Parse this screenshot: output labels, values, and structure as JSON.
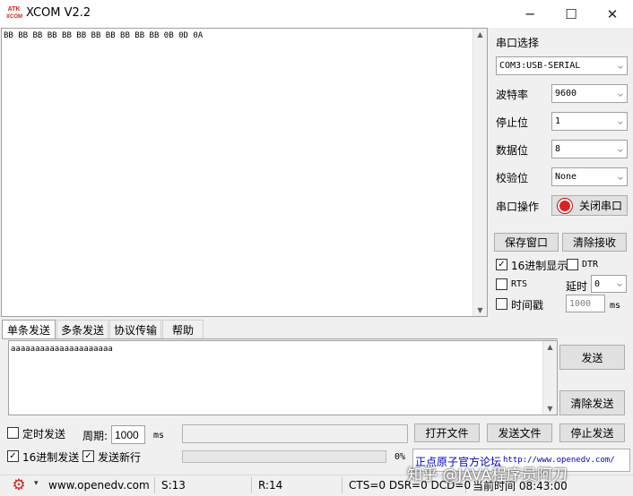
{
  "window": {
    "title": "XCOM V2.2",
    "logo_top": "ATK",
    "logo_bottom": "XCOM",
    "btn_min": "─",
    "btn_max": "☐",
    "btn_close": "✕"
  },
  "receive": {
    "text": "BB BB BB BB BB BB BB BB BB BB BB 0B 0D 0A"
  },
  "panel": {
    "port_title": "串口选择",
    "port_value": "COM3:USB-SERIAL",
    "baud_label": "波特率",
    "baud_value": "9600",
    "stop_label": "停止位",
    "stop_value": "1",
    "data_label": "数据位",
    "data_value": "8",
    "parity_label": "校验位",
    "parity_value": "None",
    "op_label": "串口操作",
    "op_button": "关闭串口",
    "save_button": "保存窗口",
    "clear_recv_button": "清除接收",
    "hex_display_label": "16进制显示",
    "hex_display_checked": true,
    "dtr_label": "DTR",
    "rts_label": "RTS",
    "delay_label": "延时",
    "delay_value": "0",
    "timestamp_label": "时间戳",
    "timestamp_value": "1000",
    "timestamp_unit": "ms"
  },
  "tabs": [
    "单条发送",
    "多条发送",
    "协议传输",
    "帮助"
  ],
  "send": {
    "text": "aaaaaaaaaaaaaaaaaaaaa",
    "send_button": "发送",
    "clear_send_button": "清除发送"
  },
  "bottom": {
    "timed_send_label": "定时发送",
    "period_label": "周期:",
    "period_value": "1000",
    "period_unit": "ms",
    "open_file_button": "打开文件",
    "send_file_button": "发送文件",
    "stop_send_button": "停止发送",
    "hex_send_label": "16进制发送",
    "hex_send_checked": true,
    "newline_label": "发送新行",
    "newline_checked": true,
    "progress_text": "0%",
    "progress_fraction": 0,
    "forum_link": "正点原子官方论坛",
    "forum_url": "http://www.openedv.com/"
  },
  "status": {
    "site": "www.openedv.com",
    "sent": "S:13",
    "received": "R:14",
    "lines": "CTS=0 DSR=0 DCD=0",
    "time": "当前时间 08:43:00"
  },
  "watermark": "知乎 @JAVA程序员阿刀",
  "colors": {
    "accent": "#d42020",
    "link": "#0000cc"
  }
}
